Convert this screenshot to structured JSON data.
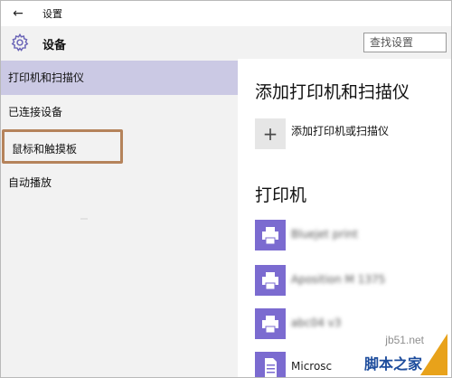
{
  "titlebar": {
    "back_icon": "back-arrow-icon",
    "back_glyph": "←",
    "title": "设置"
  },
  "header": {
    "icon": "gear-icon",
    "title": "设备",
    "search_placeholder": "查找设置"
  },
  "sidebar": {
    "items": [
      {
        "label": "打印机和扫描仪",
        "selected": true
      },
      {
        "label": "已连接设备",
        "selected": false
      },
      {
        "label": "鼠标和触摸板",
        "selected": false,
        "highlighted": true
      },
      {
        "label": "自动播放",
        "selected": false
      }
    ]
  },
  "content": {
    "section1_title": "添加打印机和扫描仪",
    "add_icon": "plus-icon",
    "add_glyph": "+",
    "add_label": "添加打印机或扫描仪",
    "section2_title": "打印机",
    "printers": [
      {
        "name": "Bluejet print",
        "icon": "printer-icon",
        "obscured": true
      },
      {
        "name": "Aposition M 1375",
        "icon": "printer-icon",
        "obscured": true
      },
      {
        "name": "abc04 v3",
        "icon": "printer-icon",
        "obscured": true
      },
      {
        "name": "Microsc",
        "icon": "document-icon",
        "obscured": false
      }
    ]
  },
  "watermark": {
    "top": "jb51.net",
    "bottom": "脚本之家"
  },
  "colors": {
    "selected_bg": "#cbc9e4",
    "highlight_border": "#b5835b",
    "printer_tile": "#7b6bd0",
    "sidebar_bg": "#f2f2f2"
  }
}
